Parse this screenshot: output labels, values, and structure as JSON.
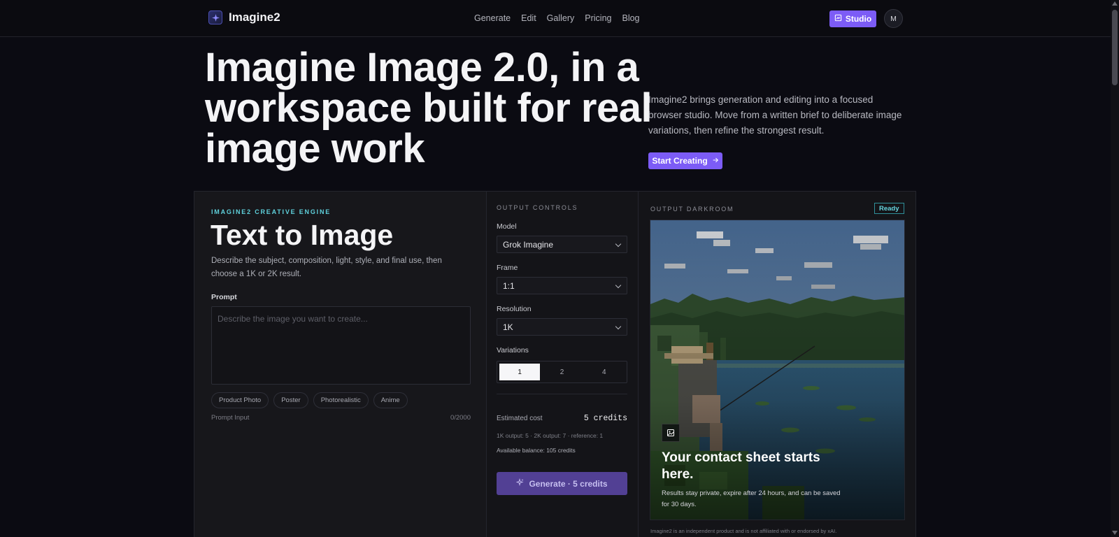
{
  "brand": {
    "name": "Imagine2"
  },
  "nav": {
    "items": [
      "Generate",
      "Edit",
      "Gallery",
      "Pricing",
      "Blog"
    ]
  },
  "header": {
    "studio_label": "Studio",
    "avatar_initial": "M"
  },
  "hero": {
    "title": "Imagine Image 2.0, in a workspace built for real image work",
    "description": "Imagine2 brings generation and editing into a focused browser studio. Move from a written brief to deliberate image variations, then refine the strongest result.",
    "cta_label": "Start Creating"
  },
  "composer": {
    "eyebrow": "IMAGINE2 CREATIVE ENGINE",
    "title": "Text to Image",
    "description": "Describe the subject, composition, light, style, and final use, then choose a 1K or 2K result.",
    "prompt_label": "Prompt",
    "prompt_placeholder": "Describe the image you want to create...",
    "prompt_value": "",
    "chips": [
      "Product Photo",
      "Poster",
      "Photorealistic",
      "Anime"
    ],
    "footer_label": "Prompt Input",
    "counter": "0/2000"
  },
  "controls": {
    "eyebrow": "OUTPUT CONTROLS",
    "model_label": "Model",
    "model_value": "Grok Imagine",
    "frame_label": "Frame",
    "frame_value": "1:1",
    "resolution_label": "Resolution",
    "resolution_value": "1K",
    "variations_label": "Variations",
    "variations": [
      "1",
      "2",
      "4"
    ],
    "variations_selected": "1",
    "cost_label": "Estimated cost",
    "cost_value": "5 credits",
    "cost_detail": "1K output: 5 · 2K output: 7 · reference: 1",
    "balance": "Available balance: 105 credits",
    "generate_label": "Generate · 5 credits"
  },
  "darkroom": {
    "eyebrow": "OUTPUT DARKROOM",
    "status": "Ready",
    "empty_title": "Your contact sheet starts here.",
    "empty_desc": "Results stay private, expire after 24 hours, and can be saved for 30 days.",
    "disclaimer": "Imagine2 is an independent product and is not affiliated with or endorsed by xAI."
  },
  "colors": {
    "accent": "#7c5cf6",
    "accent_teal": "#5fd1dc",
    "background": "#0b0b12",
    "panel": "#17171b"
  },
  "icons": {
    "logo": "sparkle-logo-icon",
    "studio": "image-edit-icon",
    "cta": "arrow-right-icon",
    "generate": "sparkles-icon",
    "preview": "image-icon"
  }
}
